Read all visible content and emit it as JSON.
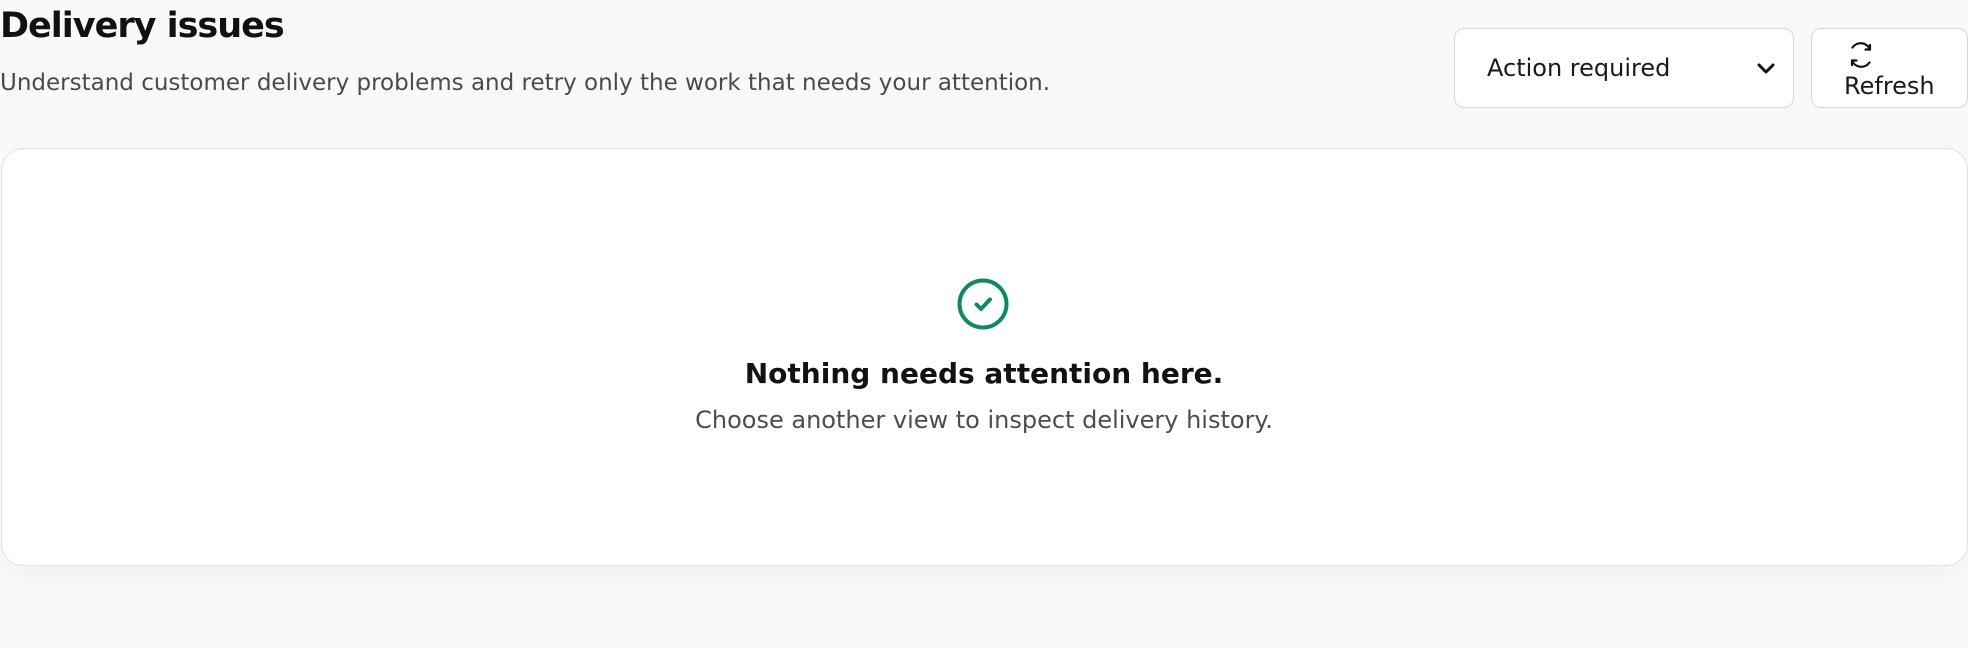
{
  "header": {
    "title": "Delivery issues",
    "subtitle": "Understand customer delivery problems and retry only the work that needs your attention."
  },
  "filter": {
    "selected": "Action required",
    "icon": "chevron-down-icon"
  },
  "actions": {
    "refresh_label": "Refresh",
    "refresh_icon": "refresh-icon"
  },
  "empty_state": {
    "icon": "check-circle-icon",
    "title": "Nothing needs attention here.",
    "text": "Choose another view to inspect delivery history."
  },
  "colors": {
    "background": "#f9f9f9",
    "card": "#ffffff",
    "border": "#d7d7d7",
    "accent_green": "#10895f",
    "text_primary": "#111111",
    "text_secondary": "#4a4a4a"
  }
}
